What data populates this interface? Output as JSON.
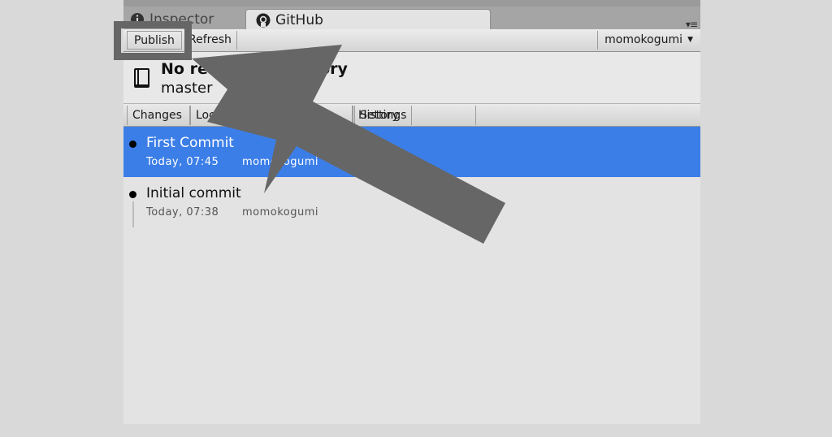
{
  "tabs": {
    "inspector": "Inspector",
    "github": "GitHub"
  },
  "toolbar": {
    "publish": "Publish",
    "refresh": "Refresh",
    "user": "momokogumi"
  },
  "repo": {
    "title": "No remote repository",
    "branch": "master"
  },
  "subtabs": {
    "changes": "Changes",
    "locks": "Locks",
    "history": "History",
    "settings": "Settings"
  },
  "history": [
    {
      "message": "First Commit",
      "date": "Today, 07:45",
      "author": "momokogumi",
      "selected": true
    },
    {
      "message": "Initial commit",
      "date": "Today, 07:38",
      "author": "momokogumi",
      "selected": false
    }
  ],
  "icons": {
    "inspector": "info-icon",
    "github": "github-icon",
    "repo": "book-icon",
    "menu": "panel-menu-icon"
  },
  "colors": {
    "selection": "#3b7ee8",
    "annotation": "#666666"
  }
}
